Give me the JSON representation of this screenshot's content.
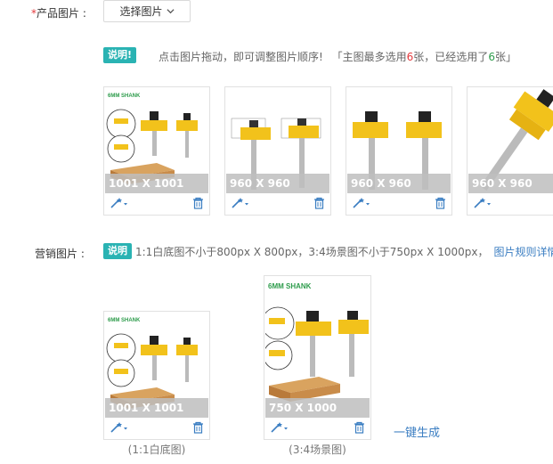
{
  "product_images": {
    "required_mark": "*",
    "label": "产品图片 :",
    "select_button": "选择图片",
    "tip_badge": "说明!",
    "tip_text": "点击图片拖动，即可调整图片顺序!",
    "limit_prefix": "「主图最多选用",
    "limit_max": "6",
    "limit_mid": "张，已经选用了",
    "limit_used": "6",
    "limit_suffix": "张」",
    "images": [
      {
        "dimension": "1001 X 1001",
        "thumb_title": "6MM SHANK"
      },
      {
        "dimension": "960 X 960"
      },
      {
        "dimension": "960 X 960"
      },
      {
        "dimension": "960 X 960"
      }
    ]
  },
  "marketing_images": {
    "label": "营销图片 :",
    "tip_badge": "说明",
    "tip_text": "1:1白底图不小于800px X 800px，3:4场景图不小于750px X 1000px，",
    "rules_link": "图片规则详情",
    "images": [
      {
        "dimension": "1001 X 1001",
        "thumb_title": "6MM SHANK",
        "caption": "(1:1白底图)"
      },
      {
        "dimension": "750 X 1000",
        "thumb_title": "6MM SHANK",
        "caption": "(3:4场景图)"
      }
    ],
    "generate_link": "一键生成"
  },
  "colors": {
    "accent": "#2ab3b3",
    "link": "#3b7ec2",
    "required": "#e4393c",
    "count_used": "#2e9c4c",
    "router_bit_yellow": "#f2c21b",
    "wood": "#d9a35f"
  },
  "icons": {
    "edit": "magic-wand-icon",
    "delete": "trash-icon",
    "dropdown": "chevron-down-icon"
  }
}
